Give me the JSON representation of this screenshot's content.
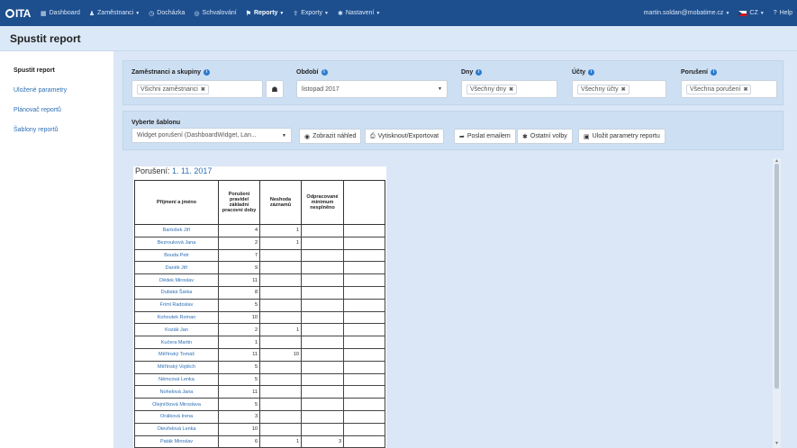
{
  "nav": {
    "logo": "ITA",
    "items": [
      {
        "label": "Dashboard",
        "icon": "dashboard-icon",
        "glyph": "▦",
        "caret": false
      },
      {
        "label": "Zaměstnanci",
        "icon": "user-icon",
        "glyph": "♟",
        "caret": true
      },
      {
        "label": "Docházka",
        "icon": "clock-icon",
        "glyph": "◷",
        "caret": false
      },
      {
        "label": "Schvalování",
        "icon": "check-circle-icon",
        "glyph": "◎",
        "caret": false
      },
      {
        "label": "Reporty",
        "icon": "report-icon",
        "glyph": "⚑",
        "caret": true,
        "active": true
      },
      {
        "label": "Exporty",
        "icon": "export-icon",
        "glyph": "⇪",
        "caret": true
      },
      {
        "label": "Nastavení",
        "icon": "gear-icon",
        "glyph": "✱",
        "caret": true
      }
    ],
    "user": "martin.soldan@mobatime.cz",
    "language": "CZ",
    "help": "Help"
  },
  "page": {
    "title": "Spustit report"
  },
  "sidebar": {
    "items": [
      "Spustit report",
      "Uložené parametry",
      "Plánovač reportů",
      "Šablony reportů"
    ]
  },
  "filters": {
    "employees": {
      "label": "Zaměstnanci a skupiny",
      "value": "Všichni zaměstnanci"
    },
    "period": {
      "label": "Období",
      "value": "listopad 2017"
    },
    "days": {
      "label": "Dny",
      "value": "Všechny dny"
    },
    "accounts": {
      "label": "Účty",
      "value": "Všechny účty"
    },
    "violations": {
      "label": "Porušení",
      "value": "Všechna porušení"
    }
  },
  "template": {
    "label": "Vyberte šablonu",
    "value": "Widget porušení (DashboardWidget, Lan...",
    "buttons": {
      "preview": "Zobrazit náhled",
      "print": "Vytisknout/Exportovat",
      "email": "Poslat emailem",
      "options": "Ostatní volby",
      "save": "Uložit parametry reportu"
    }
  },
  "report": {
    "title_prefix": "Porušení:",
    "date": "1. 11. 2017",
    "headers": [
      "Příjmení a jméno",
      "Porušení pravidel základní pracovní doby",
      "Neshoda záznamů",
      "Odpracované minimum nesplněno",
      ""
    ],
    "rows": [
      {
        "name": "Bartošek Jiří",
        "a": "4",
        "b": "1",
        "c": ""
      },
      {
        "name": "Bezrouková Jana",
        "a": "2",
        "b": "1",
        "c": ""
      },
      {
        "name": "Bouda Petr",
        "a": "7",
        "b": "",
        "c": ""
      },
      {
        "name": "Daněk Jiří",
        "a": "9",
        "b": "",
        "c": ""
      },
      {
        "name": "Dědek Miroslav",
        "a": "11",
        "b": "",
        "c": ""
      },
      {
        "name": "Dubská Šárka",
        "a": "8",
        "b": "",
        "c": ""
      },
      {
        "name": "Friml Radoslav",
        "a": "5",
        "b": "",
        "c": ""
      },
      {
        "name": "Kohoutek Roman",
        "a": "10",
        "b": "",
        "c": ""
      },
      {
        "name": "Kozák Jan",
        "a": "2",
        "b": "1",
        "c": ""
      },
      {
        "name": "Kučera Martin",
        "a": "1",
        "b": "",
        "c": ""
      },
      {
        "name": "Měřínský Tomáš",
        "a": "11",
        "b": "10",
        "c": ""
      },
      {
        "name": "Měřínský Vojtěch",
        "a": "5",
        "b": "",
        "c": ""
      },
      {
        "name": "Němcová Lenka",
        "a": "5",
        "b": "",
        "c": ""
      },
      {
        "name": "Nohelová Jana",
        "a": "11",
        "b": "",
        "c": ""
      },
      {
        "name": "Olejníčková Miroslava",
        "a": "5",
        "b": "",
        "c": ""
      },
      {
        "name": "Orálková Irena",
        "a": "3",
        "b": "",
        "c": ""
      },
      {
        "name": "Otevřelová Lenka",
        "a": "10",
        "b": "",
        "c": ""
      },
      {
        "name": "Paták Miroslav",
        "a": "6",
        "b": "1",
        "c": "3"
      }
    ]
  }
}
